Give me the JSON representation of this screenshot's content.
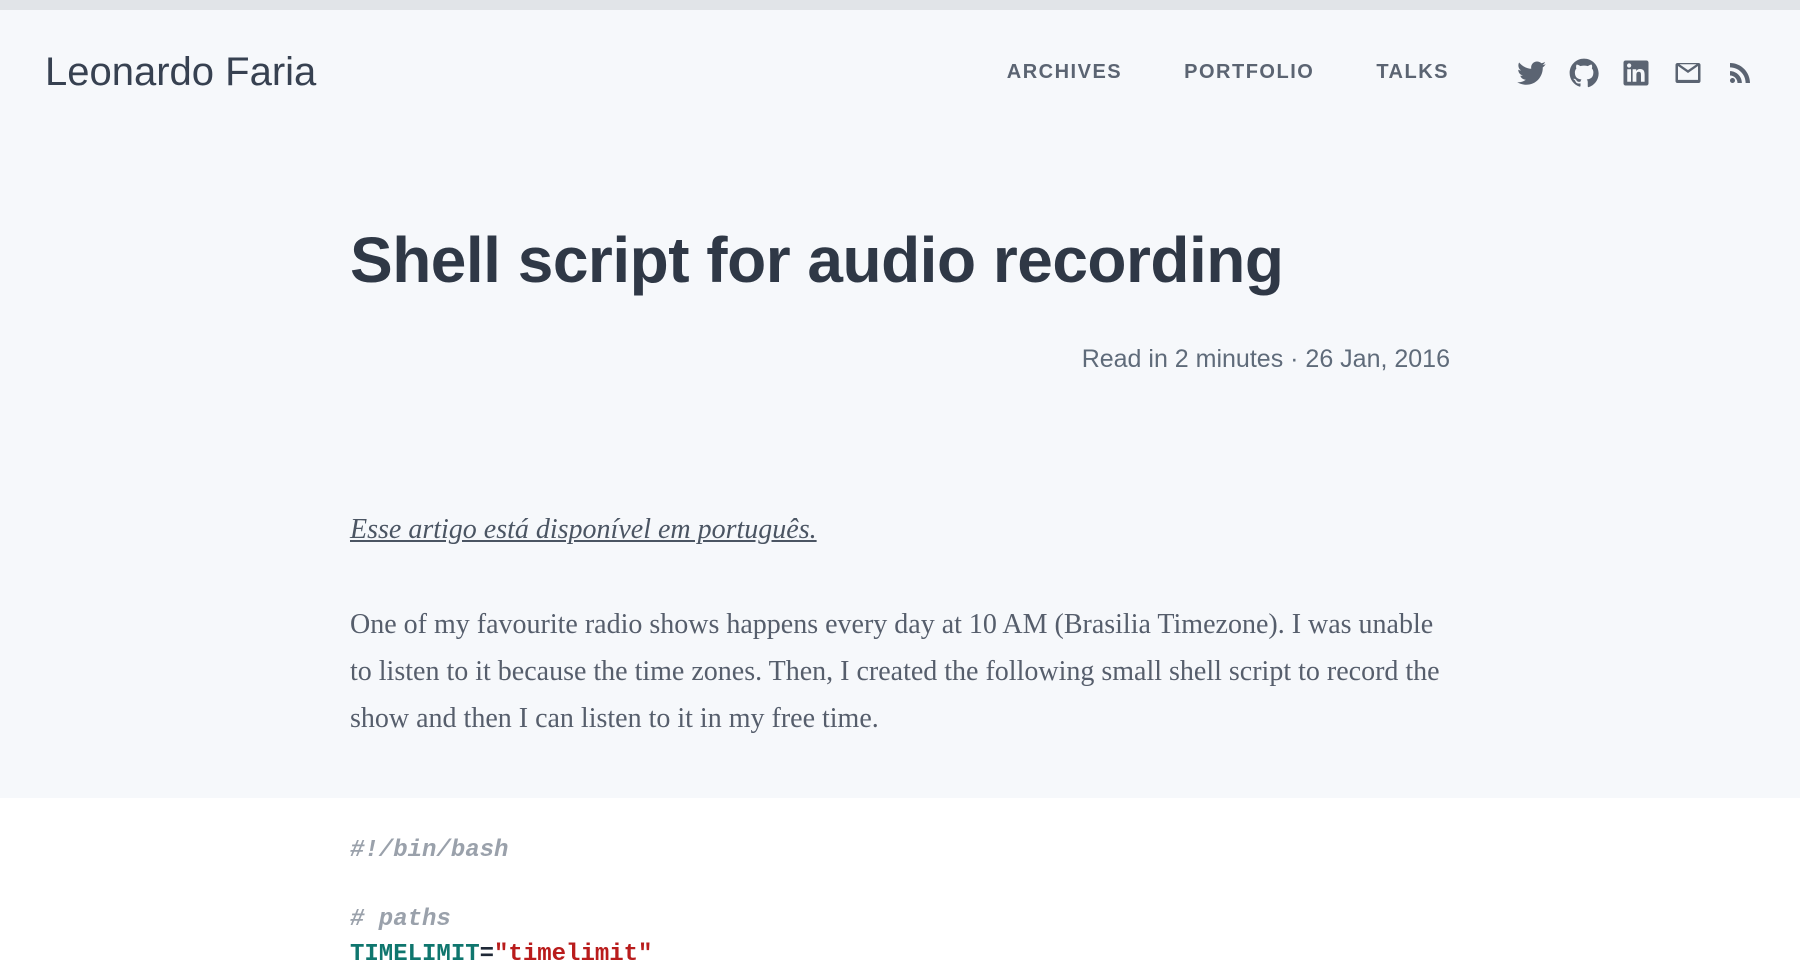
{
  "header": {
    "site_title": "Leonardo Faria",
    "nav": {
      "archives": "ARCHIVES",
      "portfolio": "PORTFOLIO",
      "talks": "TALKS"
    },
    "icons": {
      "twitter": "twitter-icon",
      "github": "github-icon",
      "linkedin": "linkedin-icon",
      "email": "email-icon",
      "rss": "rss-icon"
    }
  },
  "post": {
    "title": "Shell script for audio recording",
    "read_time": "Read in 2 minutes",
    "date": "26 Jan, 2016",
    "meta_separator": " · ",
    "pt_link": "Esse artigo está disponível em português.",
    "body": "One of my favourite radio shows happens every day at 10 AM (Brasilia Timezone). I was unable to listen to it because the time zones. Then, I created the following small shell script to record the show and then I can listen to it in my free time."
  },
  "code": {
    "shebang": "#!/bin/bash",
    "comment_paths": "# paths",
    "line_var1": "TIMELIMIT",
    "eq": "=",
    "line_val1": "\"timelimit\""
  }
}
